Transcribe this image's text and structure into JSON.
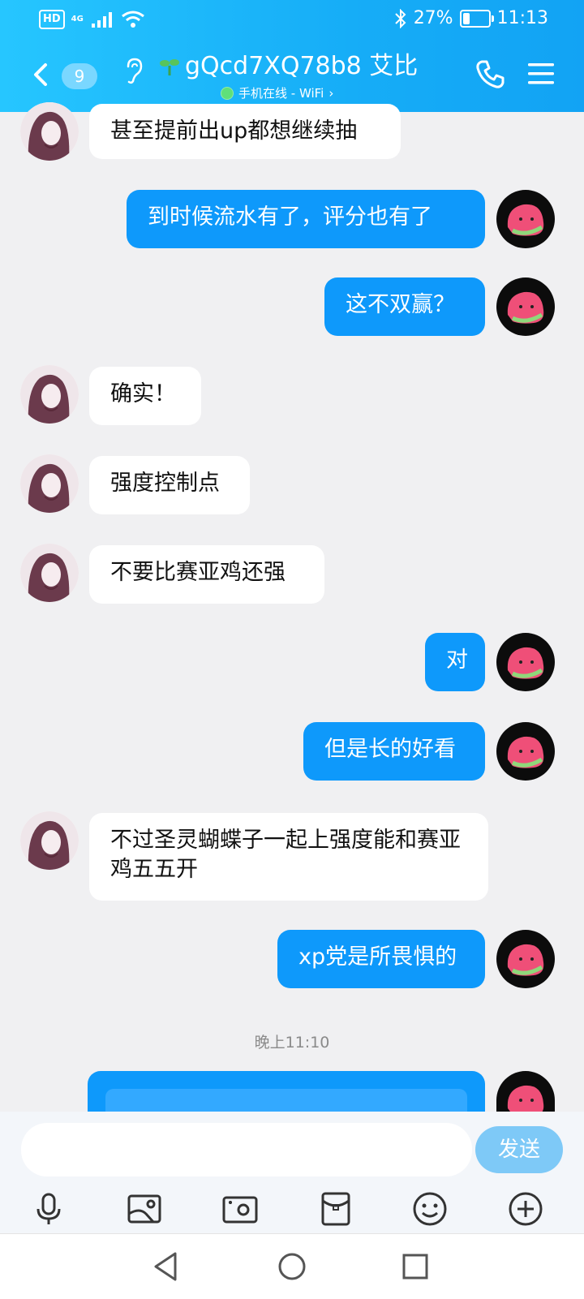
{
  "status": {
    "hd": "HD",
    "net": "4G",
    "battery_text": "27%",
    "battery_level": 0.27,
    "time": "11:13"
  },
  "header": {
    "unread_count": "9",
    "title": "gQcd7XQ78b8 艾比",
    "subtitle": "手机在线 - WiFi",
    "subtitle_arrow": "›"
  },
  "messages": [
    {
      "side": "in",
      "text": "甚至提前出up都想继续抽"
    },
    {
      "side": "out",
      "text": "到时候流水有了，评分也有了"
    },
    {
      "side": "out",
      "text": "这不双赢？"
    },
    {
      "side": "in",
      "text": "确实！"
    },
    {
      "side": "in",
      "text": "强度控制点"
    },
    {
      "side": "in",
      "text": "不要比赛亚鸡还强"
    },
    {
      "side": "out",
      "text": "对"
    },
    {
      "side": "out",
      "text": "但是长的好看"
    },
    {
      "side": "in",
      "text": "不过圣灵蝴蝶子一起上强度能和赛亚鸡五五开"
    },
    {
      "side": "out",
      "text": "xp党是所畏惧的"
    }
  ],
  "timestamp": "晚上11:10",
  "composer": {
    "placeholder": "",
    "send_label": "发送"
  },
  "colors": {
    "header": "#16adf7",
    "bubble_out": "#0e99fb",
    "bubble_in": "#ffffff",
    "send": "#7ec9f7"
  }
}
